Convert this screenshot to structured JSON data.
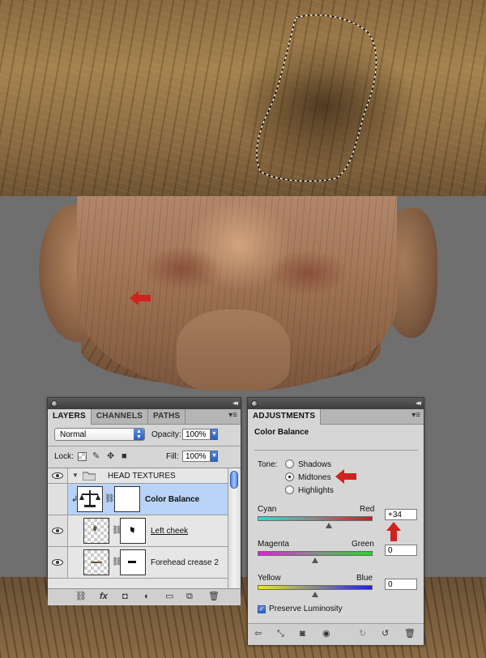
{
  "layers_panel": {
    "tabs": [
      {
        "label": "LAYERS",
        "active": true
      },
      {
        "label": "CHANNELS",
        "active": false
      },
      {
        "label": "PATHS",
        "active": false
      }
    ],
    "blend_mode": "Normal",
    "opacity_label": "Opacity:",
    "opacity_value": "100%",
    "lock_label": "Lock:",
    "fill_label": "Fill:",
    "fill_value": "100%",
    "layers": [
      {
        "name": "HEAD TEXTURES",
        "type": "group",
        "visible": true
      },
      {
        "name": "Color Balance",
        "type": "adjustment",
        "selected": true,
        "visible": false
      },
      {
        "name": "Left cheek",
        "type": "pixel",
        "visible": true
      },
      {
        "name": "Forehead crease 2",
        "type": "pixel",
        "visible": true
      }
    ]
  },
  "adjustments_panel": {
    "tab": "ADJUSTMENTS",
    "title": "Color Balance",
    "tone_label": "Tone:",
    "tones": [
      {
        "label": "Shadows",
        "selected": false
      },
      {
        "label": "Midtones",
        "selected": true
      },
      {
        "label": "Highlights",
        "selected": false
      }
    ],
    "sliders": [
      {
        "left": "Cyan",
        "right": "Red",
        "value": "+34",
        "position": 0.62
      },
      {
        "left": "Magenta",
        "right": "Green",
        "value": "0",
        "position": 0.5
      },
      {
        "left": "Yellow",
        "right": "Blue",
        "value": "0",
        "position": 0.5
      }
    ],
    "preserve_luminosity": "Preserve Luminosity",
    "preserve_checked": true
  },
  "colors": {
    "annotation_arrow": "#d0221e",
    "selection_row": "#b8d3f5"
  }
}
